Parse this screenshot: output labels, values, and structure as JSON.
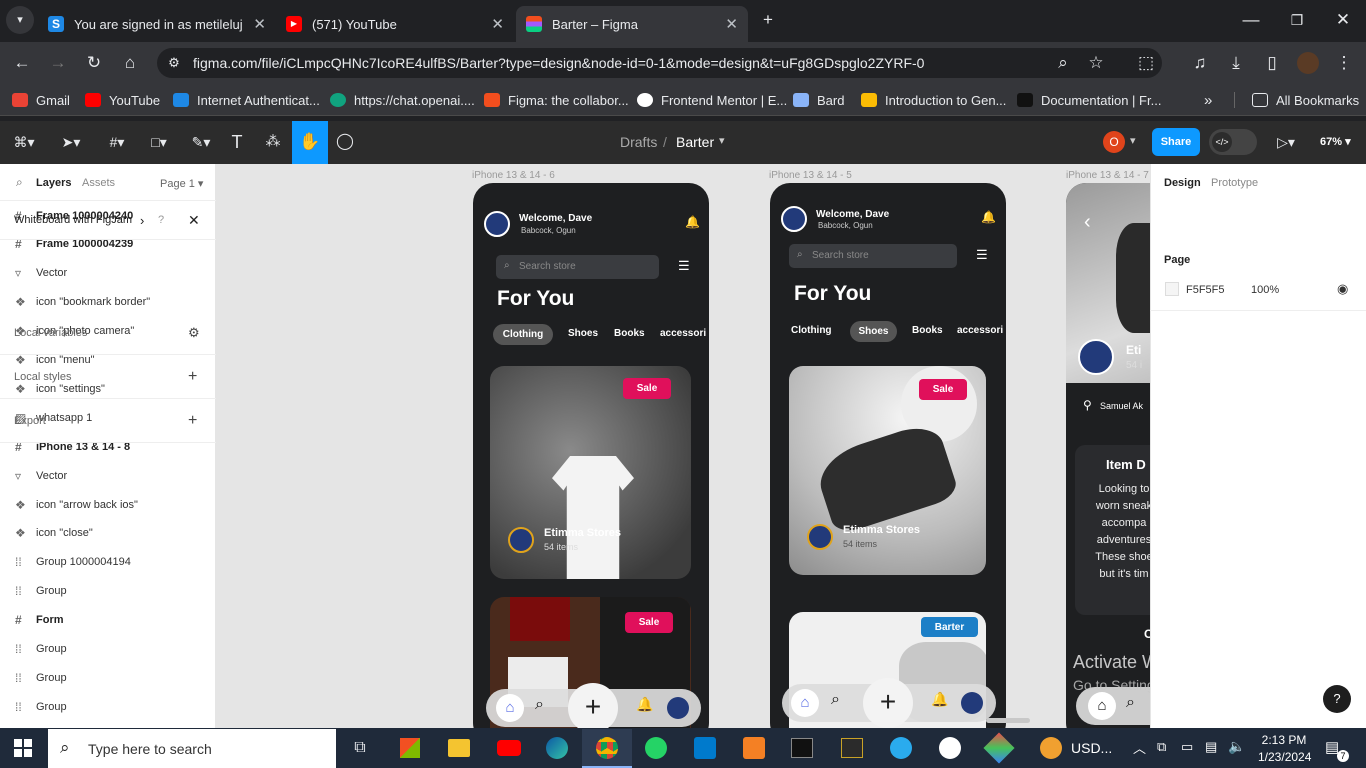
{
  "browser": {
    "tabs": [
      {
        "title": "You are signed in as metileluj",
        "favicon_color": "#1e88e5",
        "favicon_letter": "S"
      },
      {
        "title": "(571) YouTube",
        "favicon_color": "#ff0000",
        "favicon_letter": "▶"
      },
      {
        "title": "Barter – Figma",
        "favicon_color": "#f24e1e",
        "favicon_letter": "F"
      }
    ],
    "url": "figma.com/file/iCLmpcQHNc7IcoRE4ulfBS/Barter?type=design&node-id=0-1&mode=design&t=uFg8GDspglo2ZYRF-0",
    "bookmarks": [
      {
        "label": "Gmail",
        "color": "#ea4335"
      },
      {
        "label": "YouTube",
        "color": "#ff0000"
      },
      {
        "label": "Internet Authenticat...",
        "color": "#1e88e5"
      },
      {
        "label": "https://chat.openai....",
        "color": "#10a37f"
      },
      {
        "label": "Figma: the collabor...",
        "color": "#f24e1e"
      },
      {
        "label": "Frontend Mentor | E...",
        "color": "#ffffff"
      },
      {
        "label": "Bard",
        "color": "#8ab4f8"
      },
      {
        "label": "Introduction to Gen...",
        "color": "#fbbc04"
      },
      {
        "label": "Documentation | Fr...",
        "color": "#000000"
      }
    ],
    "all_bookmarks": "All Bookmarks"
  },
  "figma": {
    "breadcrumb_parent": "Drafts",
    "file_name": "Barter",
    "avatar_letter": "O",
    "share_label": "Share",
    "zoom": "67%",
    "left_tabs": {
      "layers": "Layers",
      "assets": "Assets",
      "page": "Page 1"
    },
    "layers": [
      {
        "name": "Frame 1000004240",
        "type": "frame"
      },
      {
        "name": "Frame 1000004239",
        "type": "frame"
      },
      {
        "name": "Vector",
        "type": "vector"
      },
      {
        "name": "icon \"bookmark border\"",
        "type": "component"
      },
      {
        "name": "icon \"photo camera\"",
        "type": "component"
      },
      {
        "name": "icon \"menu\"",
        "type": "component"
      },
      {
        "name": "icon \"settings\"",
        "type": "component"
      },
      {
        "name": "whatsapp 1",
        "type": "image"
      },
      {
        "name": "iPhone 13 & 14 - 8",
        "type": "frame"
      },
      {
        "name": "Vector",
        "type": "vector"
      },
      {
        "name": "icon \"arrow back ios\"",
        "type": "component"
      },
      {
        "name": "icon \"close\"",
        "type": "component"
      },
      {
        "name": "Group 1000004194",
        "type": "group"
      },
      {
        "name": "Group",
        "type": "group"
      },
      {
        "name": "Form",
        "type": "frame"
      },
      {
        "name": "Group",
        "type": "group"
      },
      {
        "name": "Group",
        "type": "group"
      },
      {
        "name": "Group",
        "type": "group"
      }
    ],
    "right_tabs": {
      "design": "Design",
      "prototype": "Prototype"
    },
    "whiteboard_banner": "Whiteboard with FigJam",
    "page_section": "Page",
    "page_color": "F5F5F5",
    "page_opacity": "100%",
    "local_variables": "Local variables",
    "local_styles": "Local styles",
    "export": "Export"
  },
  "frames": {
    "f1_label": "iPhone 13 & 14 - 6",
    "f2_label": "iPhone 13 & 14 - 5",
    "f3_label": "iPhone 13 & 14 - 7",
    "welcome": "Welcome, Dave",
    "location": "Babcock, Ogun",
    "search_placeholder": "Search store",
    "heading": "For You",
    "categories": [
      "Clothing",
      "Shoes",
      "Books",
      "accessori"
    ],
    "sale": "Sale",
    "barter": "Barter",
    "store_name": "Etimma Stores",
    "store_items": "54 items",
    "f3_store_initial": "Eti",
    "f3_items": "54 i",
    "f3_location": "Samuel Ak",
    "f3_item_title": "Item D",
    "f3_desc": [
      "Looking to",
      "worn sneak",
      "accompa",
      "adventures",
      "These shoe",
      "but it's tim"
    ],
    "f3_c": "C"
  },
  "watermark": {
    "line1": "Activate Windows",
    "line2": "Go to Settings to activate Windows."
  },
  "taskbar": {
    "search": "Type here to search",
    "ticker": "USD...",
    "time": "2:13 PM",
    "date": "1/23/2024",
    "notif_count": "7"
  }
}
